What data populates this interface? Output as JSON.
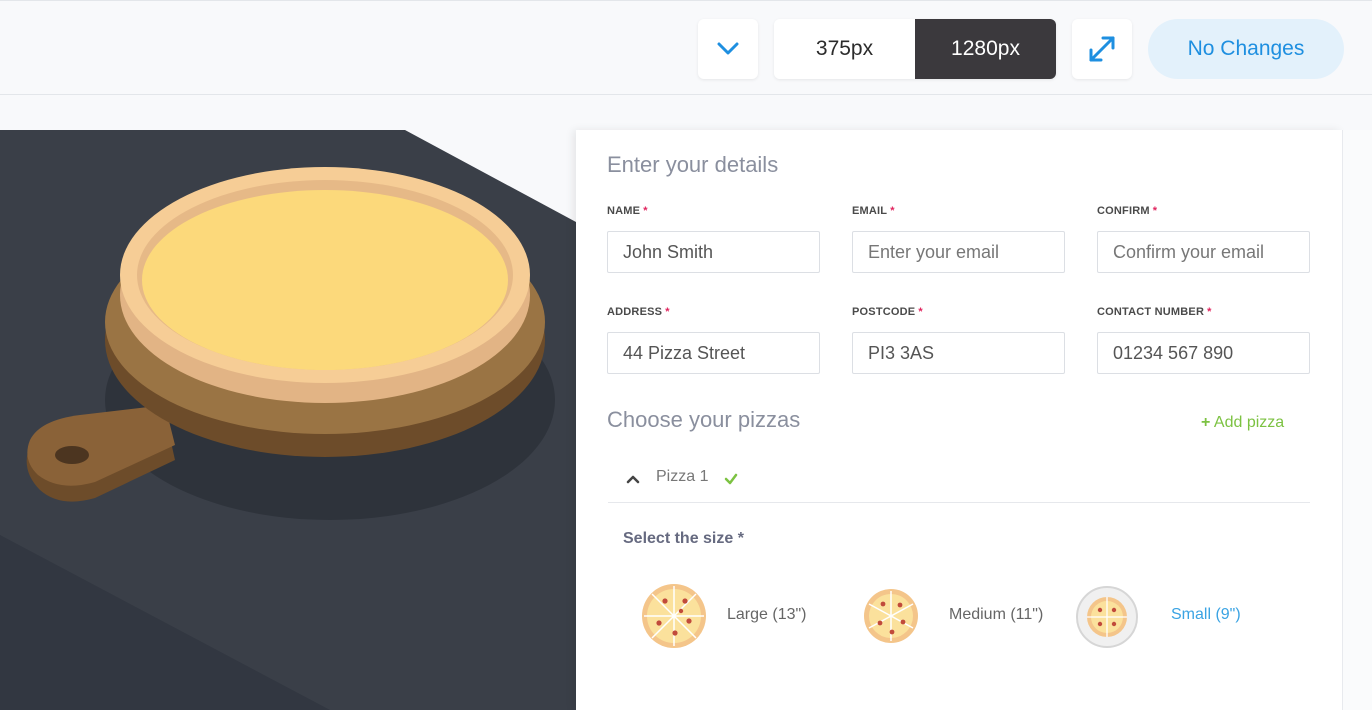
{
  "toolbar": {
    "viewport_options": [
      "375px",
      "1280px"
    ],
    "active_viewport": "1280px",
    "status_label": "No Changes"
  },
  "form": {
    "details_title": "Enter your details",
    "fields": [
      {
        "label": "NAME",
        "value": "John Smith",
        "placeholder": ""
      },
      {
        "label": "EMAIL",
        "value": "",
        "placeholder": "Enter your email"
      },
      {
        "label": "CONFIRM",
        "value": "",
        "placeholder": "Confirm your email"
      },
      {
        "label": "ADDRESS",
        "value": "44 Pizza Street",
        "placeholder": ""
      },
      {
        "label": "POSTCODE",
        "value": "PI3 3AS",
        "placeholder": ""
      },
      {
        "label": "CONTACT NUMBER",
        "value": "01234 567 890",
        "placeholder": ""
      }
    ],
    "required_mark": "*",
    "pizzas_title": "Choose your pizzas",
    "add_pizza_label": "Add pizza",
    "pizza_item_label": "Pizza 1",
    "size_title": "Select the size *",
    "sizes": [
      {
        "label": "Large (13\")",
        "selected": false
      },
      {
        "label": "Medium (11\")",
        "selected": false
      },
      {
        "label": "Small (9\")",
        "selected": true
      }
    ]
  },
  "colors": {
    "accent_blue": "#1e8fe0",
    "dark_segment": "#3b393d",
    "green": "#7cc242",
    "required": "#e0245e",
    "stage_dark": "#3b4048"
  }
}
